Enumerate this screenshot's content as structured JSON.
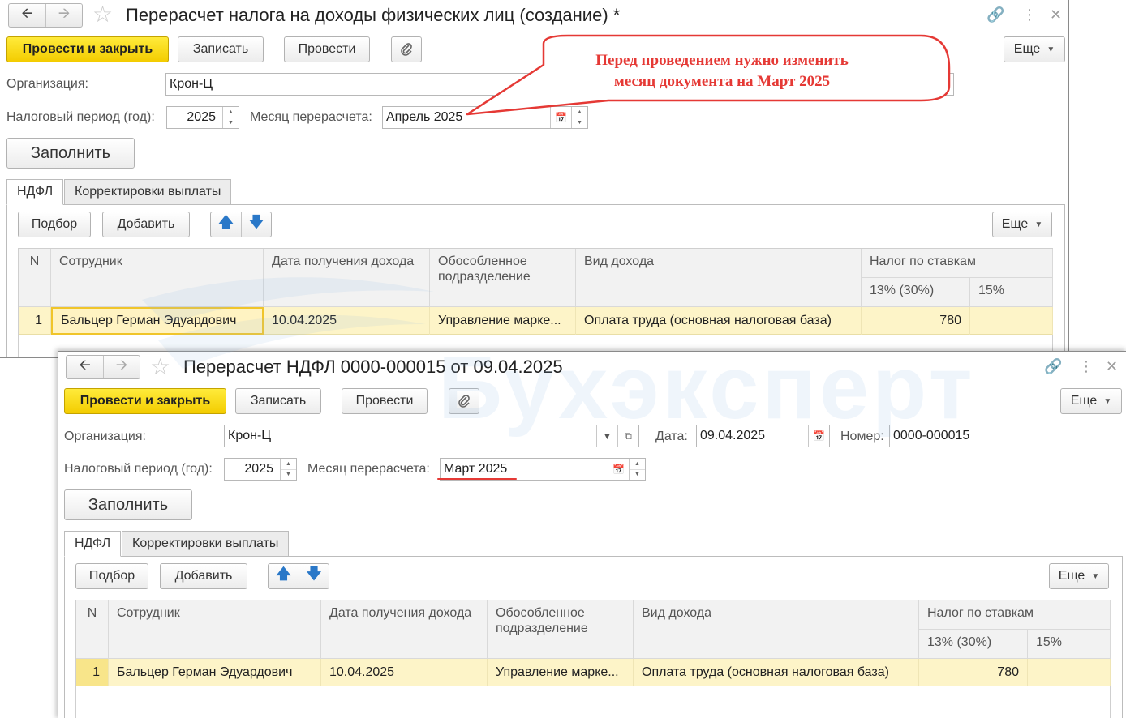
{
  "callout": {
    "line1": "Перед проведением нужно изменить",
    "line2": "месяц документа на Март 2025",
    "color": "#e53935"
  },
  "watermark": {
    "text": "Бухэксперт"
  },
  "back_window": {
    "title": "Перерасчет налога на доходы физических лиц (создание) *",
    "toolbar": {
      "post_close": "Провести и закрыть",
      "save": "Записать",
      "post": "Провести",
      "more": "Еще"
    },
    "organization": {
      "label": "Организация:",
      "value": "Крон-Ц"
    },
    "tax_period": {
      "label": "Налоговый период (год):",
      "value": "2025"
    },
    "month": {
      "label": "Месяц перерасчета:",
      "value": "Апрель 2025"
    },
    "fill_button": "Заполнить",
    "tabs": [
      "НДФЛ",
      "Корректировки выплаты"
    ],
    "table_toolbar": {
      "pick": "Подбор",
      "add": "Добавить",
      "more": "Еще"
    },
    "columns": {
      "n": "N",
      "employee": "Сотрудник",
      "income_date": "Дата получения дохода",
      "subdivision": "Обособленное подразделение",
      "income_type": "Вид дохода",
      "tax_by_rates": "Налог по ставкам",
      "rate13": "13% (30%)",
      "rate15": "15%"
    },
    "rows": [
      {
        "n": "1",
        "employee": "Бальцер Герман Эдуардович",
        "income_date": "10.04.2025",
        "subdivision": "Управление марке...",
        "income_type": "Оплата труда (основная налоговая база)",
        "rate13": "780",
        "rate15": ""
      }
    ]
  },
  "front_window": {
    "title": "Перерасчет НДФЛ 0000-000015 от 09.04.2025",
    "toolbar": {
      "post_close": "Провести и закрыть",
      "save": "Записать",
      "post": "Провести",
      "more": "Еще"
    },
    "organization": {
      "label": "Организация:",
      "value": "Крон-Ц"
    },
    "date": {
      "label": "Дата:",
      "value": "09.04.2025"
    },
    "number": {
      "label": "Номер:",
      "value": "0000-000015"
    },
    "tax_period": {
      "label": "Налоговый период (год):",
      "value": "2025"
    },
    "month": {
      "label": "Месяц перерасчета:",
      "value": "Март 2025"
    },
    "fill_button": "Заполнить",
    "tabs": [
      "НДФЛ",
      "Корректировки выплаты"
    ],
    "table_toolbar": {
      "pick": "Подбор",
      "add": "Добавить",
      "more": "Еще"
    },
    "columns": {
      "n": "N",
      "employee": "Сотрудник",
      "income_date": "Дата получения дохода",
      "subdivision": "Обособленное подразделение",
      "income_type": "Вид дохода",
      "tax_by_rates": "Налог по ставкам",
      "rate13": "13% (30%)",
      "rate15": "15%"
    },
    "rows": [
      {
        "n": "1",
        "employee": "Бальцер Герман Эдуардович",
        "income_date": "10.04.2025",
        "subdivision": "Управление марке...",
        "income_type": "Оплата труда (основная налоговая база)",
        "rate13": "780",
        "rate15": ""
      }
    ]
  }
}
